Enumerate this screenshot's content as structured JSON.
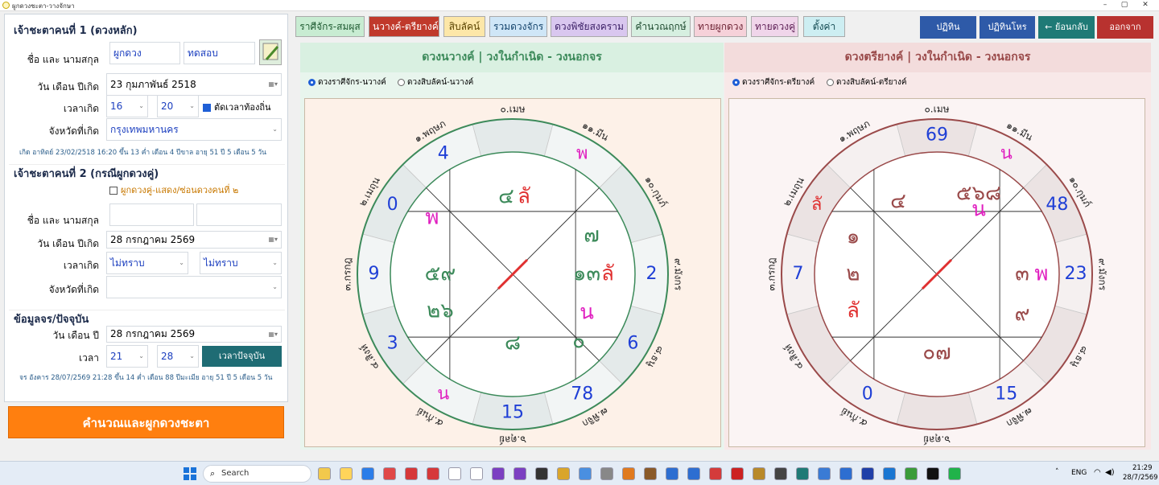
{
  "window": {
    "title": "ผูกดวงชะตา-วางจักษา",
    "min": "–",
    "max": "▢",
    "close": "✕"
  },
  "person1": {
    "heading": "เจ้าชะตาคนที่ 1 (ดวงหลัก)",
    "name_label": "ชื่อ และ นามสกุล",
    "first_name": "ผูกดวง",
    "last_name": "ทดสอบ",
    "date_label": "วัน เดือน ปีเกิด",
    "birth_date": "23  กุมภาพันธ์   2518",
    "time_label": "เวลาเกิด",
    "hour": "16",
    "minute": "20",
    "local_time_label": "ตัดเวลาท้องถิ่น",
    "province_label": "จังหวัดที่เกิด",
    "province": "กรุงเทพมหานคร",
    "summary": "เกิด อาทิตย์ 23/02/2518 16:20 ขึ้น 13 ค่ำ เดือน 4 ปีขาล อายุ 51 ปี 5 เดือน 5 วัน"
  },
  "person2": {
    "heading": "เจ้าชะตาคนที่ 2 (กรณีผูกดวงคู่)",
    "pair_label": "ผูกดวงคู่-แสดง/ซ่อนดวงคนที่ ๒",
    "name_label": "ชื่อ และ นามสกุล",
    "first_name": "",
    "last_name": "",
    "date_label": "วัน เดือน ปีเกิด",
    "birth_date": "28  กรกฎาคม    2569",
    "time_label": "เวลาเกิด",
    "hour": "ไม่ทราบ",
    "minute": "ไม่ทราบ",
    "province_label": "จังหวัดที่เกิด",
    "province": ""
  },
  "current": {
    "heading": "ข้อมูลจร/ปัจจุบัน",
    "date_label": "วัน เดือน ปี",
    "date": "28  กรกฎาคม    2569",
    "time_label": "เวลา",
    "hour": "21",
    "minute": "28",
    "now_button": "เวลาปัจจุบัน",
    "summary": "จร อังคาร 28/07/2569 21:28 ขึ้น 14 ค่ำ เดือน 88 ปีมะเมีย อายุ 51 ปี 5 เดือน 5 วัน"
  },
  "calc_button": "คำนวณและผูกดวงชะตา",
  "tabs": [
    {
      "label": "ราศีจักร-สมผุส",
      "bg": "#c8ecd2",
      "fg": "#1d5a30",
      "active": false
    },
    {
      "label": "นวางค์-ตรียางค์",
      "bg": "#c0392b",
      "fg": "#ffffff",
      "active": true
    },
    {
      "label": "สิบลัคน์",
      "bg": "#fde7a8",
      "fg": "#5a4300",
      "active": false
    },
    {
      "label": "รวมดวงจักร",
      "bg": "#cfe6f7",
      "fg": "#14436b",
      "active": false
    },
    {
      "label": "ดวงพิชัยสงคราม",
      "bg": "#d9c7ef",
      "fg": "#3b1f66",
      "active": false
    },
    {
      "label": "คำนวณฤกษ์",
      "bg": "#d6efe0",
      "fg": "#1d4a2e",
      "active": false
    },
    {
      "label": "ทายผูกดวง",
      "bg": "#f6d1d9",
      "fg": "#6a1f30",
      "active": false
    },
    {
      "label": "ทายดวงคู่",
      "bg": "#f0d5ea",
      "fg": "#5d1f55",
      "active": false
    },
    {
      "label": "ตั้งค่า",
      "bg": "#cdeef2",
      "fg": "#134a52",
      "active": false
    }
  ],
  "top_buttons": [
    {
      "label": "ปฏิทิน",
      "bg": "#2e5aa8"
    },
    {
      "label": "ปฏิทินโหร",
      "bg": "#2e5aa8"
    },
    {
      "label": "← ย้อนกลับ",
      "bg": "#1f7a76"
    },
    {
      "label": "ออกจาก",
      "bg": "#b8322f"
    }
  ],
  "left_chart": {
    "title": "ดวงนวางค์ | วงในกำเนิด - วงนอกจร",
    "radio_a": "ดวงราศีจักร-นวางค์",
    "radio_b": "ดวงสิบลัคน์-นวางค์",
    "color": "#3c8a5a",
    "zodiac": [
      "๐.เมษ",
      "๑.พฤษภ",
      "๒.เมถุน",
      "๓.กรกฎ",
      "๔.สิงห์",
      "๕.กันย์",
      "๖.ตุลย์",
      "๗.พิจิก",
      "๘.ธนู",
      "๙.มังกร",
      "๑๐.กุมภ์",
      "๑๑.มีน"
    ],
    "outer": [
      "",
      "4",
      "0",
      "9",
      "3",
      "น",
      "15",
      "78",
      "6",
      "2",
      "",
      "พ"
    ],
    "inner": [
      {
        "text": "๔",
        "color": "#3c8a5a"
      },
      {
        "text": "ลั",
        "color": "#e03030"
      },
      {
        "text": "พ",
        "color": "#e020c0"
      },
      {
        "text": "๕๙",
        "color": "#3c8a5a"
      },
      {
        "text": "๒๖",
        "color": "#3c8a5a"
      },
      {
        "text": "๘",
        "color": "#3c8a5a"
      },
      {
        "text": "๐",
        "color": "#3c8a5a"
      },
      {
        "text": "น",
        "color": "#e020c0"
      },
      {
        "text": "๑๓",
        "color": "#3c8a5a"
      },
      {
        "text": "ลั",
        "color": "#e03030"
      },
      {
        "text": "๗",
        "color": "#3c8a5a"
      }
    ]
  },
  "right_chart": {
    "title": "ดวงตรียางค์ | วงในกำเนิด - วงนอกจร",
    "radio_a": "ดวงราศีจักร-ตรียางค์",
    "radio_b": "ดวงสิบลัคน์-ตรียางค์",
    "color": "#9a4a4a",
    "zodiac": [
      "๐.เมษ",
      "๑.พฤษภ",
      "๒.เมถุน",
      "๓.กรกฎ",
      "๔.สิงห์",
      "๕.กันย์",
      "๖.ตุลย์",
      "๗.พิจิก",
      "๘.ธนู",
      "๙.มังกร",
      "๑๐.กุมภ์",
      "๑๑.มีน"
    ],
    "outer": [
      "69",
      "",
      "ลั",
      "7",
      "",
      "0",
      "",
      "15",
      "",
      "23",
      "48",
      "น"
    ],
    "inner": [
      {
        "text": "๕๖๘",
        "color": "#9a4a4a"
      },
      {
        "text": "น",
        "color": "#e020c0"
      },
      {
        "text": "๔",
        "color": "#9a4a4a"
      },
      {
        "text": "๑",
        "color": "#9a4a4a"
      },
      {
        "text": "๒",
        "color": "#9a4a4a"
      },
      {
        "text": "ลั",
        "color": "#e03030"
      },
      {
        "text": "๐๗",
        "color": "#9a4a4a"
      },
      {
        "text": "๙",
        "color": "#9a4a4a"
      },
      {
        "text": "๓",
        "color": "#9a4a4a"
      },
      {
        "text": "พ",
        "color": "#e020c0"
      }
    ]
  },
  "taskbar": {
    "search": "Search",
    "lang": "ENG",
    "time": "21:29",
    "date": "28/7/2569"
  }
}
